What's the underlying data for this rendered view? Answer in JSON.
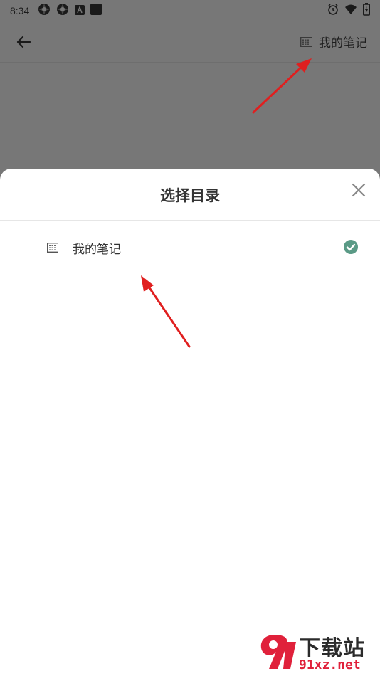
{
  "status_bar": {
    "time": "8:34"
  },
  "app_bar": {
    "back_icon": "arrow-left-icon",
    "folder_label": "我的笔记",
    "folder_icon": "list-icon"
  },
  "sheet": {
    "title": "选择目录",
    "close_icon": "close-icon",
    "items": [
      {
        "label": "我的笔记",
        "icon": "list-icon",
        "selected": true
      }
    ]
  },
  "colors": {
    "overlay": "#777777",
    "check": "#5a9a86",
    "annotation_arrow": "#e01f1f"
  },
  "watermark": {
    "name": "下载站",
    "domain": "91xz.net"
  }
}
